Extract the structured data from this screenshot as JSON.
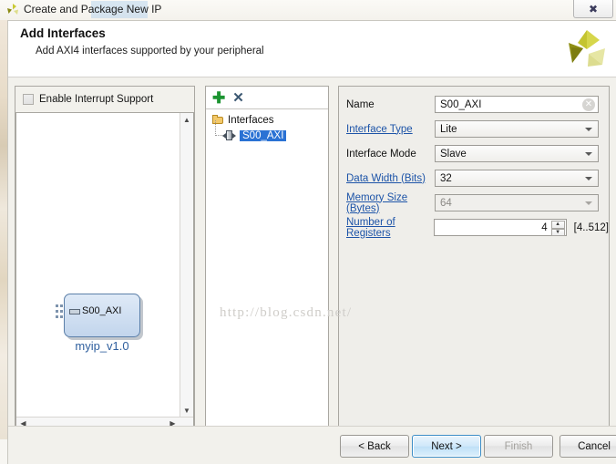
{
  "window": {
    "title": "Create and Package New IP",
    "title_icon": "xilinx-logo-icon",
    "close_label": "✖"
  },
  "header": {
    "title": "Add Interfaces",
    "subtitle": "Add AXI4 interfaces supported by your peripheral",
    "logo": "xilinx-logo-icon"
  },
  "left_panel": {
    "interrupt_checkbox_label": "Enable Interrupt Support",
    "interrupt_checked": false,
    "diagram": {
      "port_label": "S00_AXI",
      "block_name": "myip_v1.0"
    },
    "scroll_up": "▲",
    "scroll_down": "▼",
    "scroll_left": "◀",
    "scroll_right": "▶"
  },
  "tree_panel": {
    "add_icon_label": "✚",
    "delete_icon_label": "✕",
    "root_label": "Interfaces",
    "child_label": "S00_AXI"
  },
  "form": {
    "fields": [
      {
        "label": "Name",
        "value": "S00_AXI",
        "type": "text",
        "link": false,
        "disabled": false
      },
      {
        "label": "Interface Type",
        "value": "Lite",
        "type": "combo",
        "link": true,
        "disabled": false
      },
      {
        "label": "Interface Mode",
        "value": "Slave",
        "type": "combo",
        "link": false,
        "disabled": false
      },
      {
        "label": "Data Width (Bits)",
        "value": "32",
        "type": "combo",
        "link": true,
        "disabled": false
      },
      {
        "label": "Memory Size (Bytes)",
        "value": "64",
        "type": "combo",
        "link": true,
        "disabled": true
      },
      {
        "label": "Number of Registers",
        "value": "4",
        "type": "spinner",
        "link": true,
        "disabled": false
      }
    ],
    "range_note": "[4..512]",
    "spin_up": "▲",
    "spin_down": "▼"
  },
  "watermark": "http://blog.csdn.net/",
  "footer": {
    "back": "< Back",
    "next": "Next >",
    "finish": "Finish",
    "cancel": "Cancel"
  },
  "colors": {
    "link": "#1d54a8",
    "selection": "#2a72d4",
    "accent_logo": "#b3b326",
    "block_fill": "#c2d5ec"
  }
}
